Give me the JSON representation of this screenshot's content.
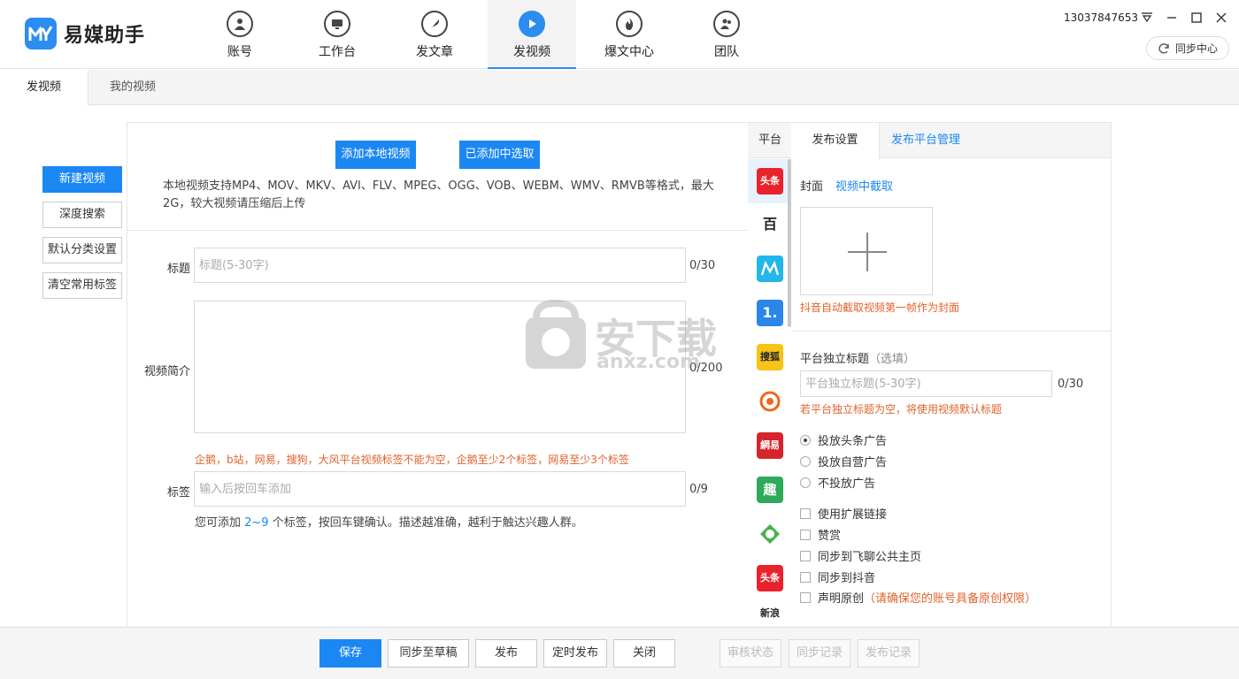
{
  "app": {
    "name": "易媒助手",
    "account": "13037847653",
    "sync_center": "同步中心"
  },
  "nav": [
    {
      "label": "账号",
      "icon": "user-icon"
    },
    {
      "label": "工作台",
      "icon": "monitor-icon"
    },
    {
      "label": "发文章",
      "icon": "feather-icon"
    },
    {
      "label": "发视频",
      "icon": "play-icon",
      "active": true
    },
    {
      "label": "爆文中心",
      "icon": "flame-icon"
    },
    {
      "label": "团队",
      "icon": "team-icon"
    }
  ],
  "subtabs": {
    "publish_video": "发视频",
    "my_videos": "我的视频"
  },
  "left_menu": {
    "new_video": "新建视频",
    "deep_search": "深度搜索",
    "default_category": "默认分类设置",
    "clear_tags": "清空常用标签"
  },
  "form": {
    "add_local": "添加本地视频",
    "pick_added": "已添加中选取",
    "support_text": "本地视频支持MP4、MOV、MKV、AVI、FLV、MPEG、OGG、VOB、WEBM、WMV、RMVB等格式，最大2G，较大视频请压缩后上传",
    "title_label": "标题",
    "title_placeholder": "标题(5-30字)",
    "title_count": "0/30",
    "desc_label": "视频简介",
    "desc_count": "0/200",
    "tag_warning": "企鹅，b站，网易，搜狗，大风平台视频标签不能为空，企鹅至少2个标签，网易至少3个标签",
    "tag_label": "标签",
    "tag_placeholder": "输入后按回车添加",
    "tag_count": "0/9",
    "tag_hint_pre": "您可添加 ",
    "tag_hint_range": "2~9",
    "tag_hint_post": " 个标签，按回车键确认。描述越准确，越利于触达兴趣人群。"
  },
  "watermark": {
    "text_cn": "安下载",
    "text_en": "anxz.com"
  },
  "platforms": {
    "header": "平台",
    "items": [
      {
        "name": "toutiao",
        "text": "头条",
        "color": "#e8232c"
      },
      {
        "name": "baijiahao",
        "text": "百",
        "color": "#ffffff"
      },
      {
        "name": "dafeng",
        "text": "",
        "color": "#23b6ea"
      },
      {
        "name": "yidian",
        "text": "1.",
        "color": "#2a86e8"
      },
      {
        "name": "sohu",
        "text": "搜狐",
        "color": "#f7c316"
      },
      {
        "name": "penguin",
        "text": "",
        "color": "#ffffff"
      },
      {
        "name": "netease",
        "text": "網易",
        "color": "#d7242a"
      },
      {
        "name": "qutoutiao",
        "text": "趣",
        "color": "#2eaa5a"
      },
      {
        "name": "aiqiyi",
        "text": "",
        "color": "#ffffff"
      },
      {
        "name": "toutiao2",
        "text": "头条",
        "color": "#e8232c"
      },
      {
        "name": "xinlang",
        "text": "新浪",
        "color": "#ffffff"
      }
    ]
  },
  "settings": {
    "tab_publish": "发布设置",
    "tab_manage": "发布平台管理",
    "cover_label": "封面",
    "cover_capture": "视频中截取",
    "cover_note": "抖音自动截取视频第一帧作为封面",
    "title_label": "平台独立标题",
    "title_optional": "（选填）",
    "title_placeholder": "平台独立标题(5-30字)",
    "title_count": "0/30",
    "title_note": "若平台独立标题为空，将使用视频默认标题",
    "ads": [
      "投放头条广告",
      "投放自营广告",
      "不投放广告"
    ],
    "checks": [
      "使用扩展链接",
      "赞赏",
      "同步到飞聊公共主页",
      "同步到抖音"
    ],
    "original_label": "声明原创",
    "original_note": "（请确保您的账号具备原创权限）"
  },
  "bottom": {
    "save": "保存",
    "sync_draft": "同步至草稿",
    "publish": "发布",
    "scheduled": "定时发布",
    "close": "关闭",
    "review": "审核状态",
    "sync_log": "同步记录",
    "publish_log": "发布记录"
  },
  "colors": {
    "primary": "#1b87f2",
    "warning": "#e0622b"
  }
}
